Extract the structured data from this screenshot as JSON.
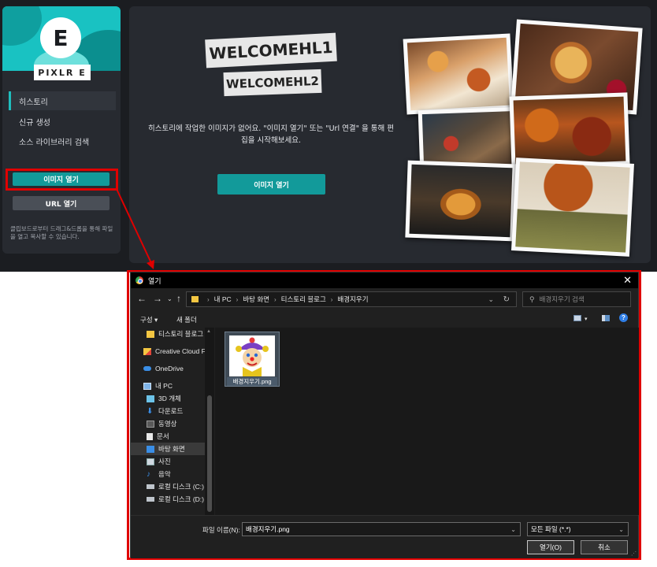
{
  "app": {
    "logo_letter": "E",
    "logo_word": "PIXLR E",
    "nav": [
      {
        "label": "히스토리"
      },
      {
        "label": "신규 생성"
      },
      {
        "label": "소스 라이브러리 검색"
      }
    ],
    "open_image_button": "이미지 열기",
    "url_open_button": "URL 열기",
    "side_hint": "클립보드로부터 드래그&드롭을 통해 파일을 열고 복사할 수 있습니다.",
    "welcome_tag1": "WELCOMEHL1",
    "welcome_tag2": "WELCOMEHL2",
    "welcome_text": "히스토리에 작업한 이미지가 없어요. \"이미지 열기\" 또는 \"Url 연결\" 을 통해 편집을 시작해보세요.",
    "main_open_button": "이미지 열기",
    "accent_color": "#129a9a"
  },
  "dialog": {
    "title": "열기",
    "close_icon": "close-icon",
    "breadcrumb": [
      "내 PC",
      "바탕 화면",
      "티스토리 블로그",
      "배경지우기"
    ],
    "search_placeholder": "배경지우기 검색",
    "toolbar": {
      "organize": "구성",
      "new_folder": "새 폴더"
    },
    "tree": [
      {
        "label": "티스토리 블로그",
        "icon": "folder-icon"
      },
      {
        "label": "Creative Cloud Fil",
        "icon": "creative-cloud-icon"
      },
      {
        "label": "OneDrive",
        "icon": "onedrive-icon"
      },
      {
        "label": "내 PC",
        "icon": "pc-icon"
      },
      {
        "label": "3D 개체",
        "icon": "cube-icon"
      },
      {
        "label": "다운로드",
        "icon": "download-icon"
      },
      {
        "label": "동영상",
        "icon": "video-icon"
      },
      {
        "label": "문서",
        "icon": "document-icon"
      },
      {
        "label": "바탕 화면",
        "icon": "desktop-icon"
      },
      {
        "label": "사진",
        "icon": "picture-icon"
      },
      {
        "label": "음악",
        "icon": "music-icon"
      },
      {
        "label": "로컬 디스크 (C:)",
        "icon": "disk-icon"
      },
      {
        "label": "로컬 디스크 (D:)",
        "icon": "disk-icon"
      }
    ],
    "file": {
      "name": "배경지우기.png"
    },
    "filename_label": "파일 이름(N):",
    "filename_value": "배경지우기.png",
    "filetype_value": "모든 파일 (*.*)",
    "open_button": "열기(O)",
    "cancel_button": "취소"
  }
}
